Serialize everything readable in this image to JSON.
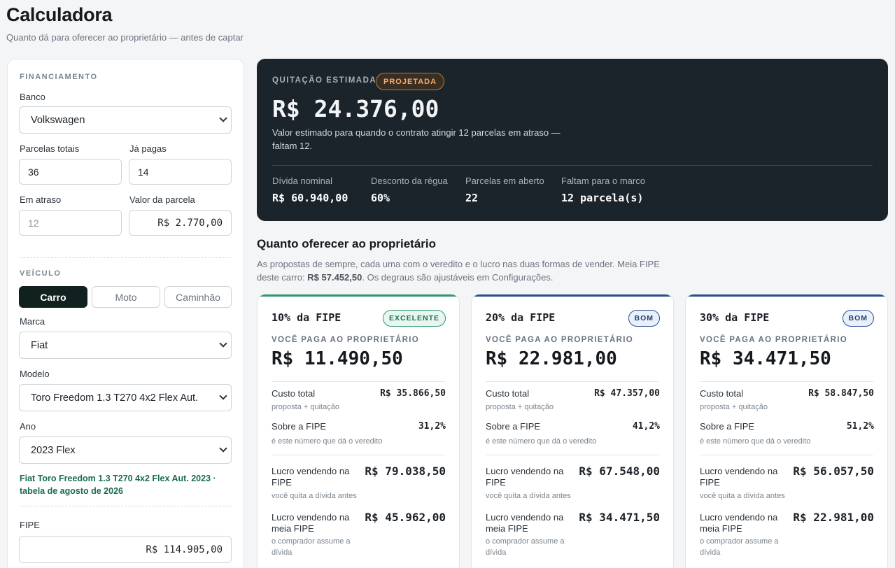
{
  "page": {
    "title": "Calculadora",
    "subtitle": "Quanto dá para oferecer ao proprietário — antes de captar"
  },
  "financiamento": {
    "section_title": "FINANCIAMENTO",
    "banco_label": "Banco",
    "banco_value": "Volkswagen",
    "parcelas_totais_label": "Parcelas totais",
    "parcelas_totais_value": "36",
    "ja_pagas_label": "Já pagas",
    "ja_pagas_value": "14",
    "em_atraso_label": "Em atraso",
    "em_atraso_placeholder": "12",
    "valor_parcela_label": "Valor da parcela",
    "valor_parcela_value": "R$ 2.770,00"
  },
  "veiculo": {
    "section_title": "VEÍCULO",
    "tipos": [
      "Carro",
      "Moto",
      "Caminhão"
    ],
    "tipo_selecionado": "Carro",
    "marca_label": "Marca",
    "marca_value": "Fiat",
    "modelo_label": "Modelo",
    "modelo_value": "Toro Freedom 1.3 T270 4x2 Flex Aut.",
    "ano_label": "Ano",
    "ano_value": "2023 Flex",
    "fipe_note": "Fiat Toro Freedom 1.3 T270 4x2 Flex Aut. 2023 · tabela de agosto de 2026",
    "fipe_label": "FIPE",
    "fipe_value": "R$ 114.905,00"
  },
  "quitacao": {
    "caption": "QUITAÇÃO ESTIMADA",
    "badge": "PROJETADA",
    "value": "R$ 24.376,00",
    "description": "Valor estimado para quando o contrato atingir 12 parcelas em atraso — faltam 12.",
    "stats": [
      {
        "label": "Dívida nominal",
        "value": "R$ 60.940,00"
      },
      {
        "label": "Desconto da régua",
        "value": "60%"
      },
      {
        "label": "Parcelas em aberto",
        "value": "22"
      },
      {
        "label": "Faltam para o marco",
        "value": "12 parcela(s)"
      }
    ]
  },
  "ofertas": {
    "title": "Quanto oferecer ao proprietário",
    "intro": "As propostas de sempre, cada uma com o veredito e o lucro nas duas formas de vender. Meia FIPE deste carro:",
    "meia_fipe": "R$ 57.452,50",
    "intro_end": ". Os degraus são ajustáveis em Configurações.",
    "labels": {
      "voce_paga": "VOCÊ PAGA AO PROPRIETÁRIO",
      "custo_total": "Custo total",
      "custo_total_sub": "proposta + quitação",
      "sobre_fipe": "Sobre a FIPE",
      "sobre_fipe_sub": "é este número que dá o veredito",
      "lucro_fipe": "Lucro vendendo na FIPE",
      "lucro_fipe_sub": "você quita a dívida antes",
      "lucro_meia": "Lucro vendendo na meia FIPE",
      "lucro_meia_sub": "o comprador assume a dívida"
    },
    "cards": [
      {
        "title": "10% da FIPE",
        "badge": "EXCELENTE",
        "valor": "R$ 11.490,50",
        "custo_total": "R$ 35.866,50",
        "sobre_fipe": "31,2%",
        "lucro_fipe": "R$ 79.038,50",
        "lucro_meia": "R$ 45.962,00"
      },
      {
        "title": "20% da FIPE",
        "badge": "BOM",
        "valor": "R$ 22.981,00",
        "custo_total": "R$ 47.357,00",
        "sobre_fipe": "41,2%",
        "lucro_fipe": "R$ 67.548,00",
        "lucro_meia": "R$ 34.471,50"
      },
      {
        "title": "30% da FIPE",
        "badge": "BOM",
        "valor": "R$ 34.471,50",
        "custo_total": "R$ 58.847,50",
        "sobre_fipe": "51,2%",
        "lucro_fipe": "R$ 56.057,50",
        "lucro_meia": "R$ 22.981,00"
      }
    ],
    "colors": {
      "excelente": "#2f9a72",
      "bom": "#2a4e8e"
    }
  }
}
